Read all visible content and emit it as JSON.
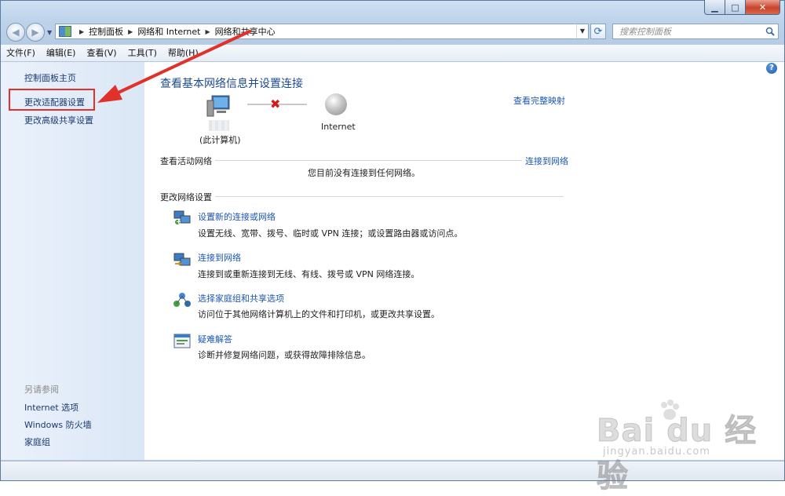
{
  "window": {
    "minimize_glyph": "▁",
    "maximize_glyph": "□",
    "close_glyph": "✕"
  },
  "address_bar": {
    "crumbs": [
      "控制面板",
      "网络和 Internet",
      "网络和共享中心"
    ]
  },
  "search": {
    "placeholder": "搜索控制面板"
  },
  "menu": [
    "文件(F)",
    "编辑(E)",
    "查看(V)",
    "工具(T)",
    "帮助(H)"
  ],
  "sidebar": {
    "home": "控制面板主页",
    "change_adapter": "更改适配器设置",
    "change_sharing": "更改高级共享设置",
    "see_also_caption": "另请参阅",
    "see_also": [
      "Internet 选项",
      "Windows 防火墙",
      "家庭组"
    ]
  },
  "main": {
    "title": "查看基本网络信息并设置连接",
    "view_full_map": "查看完整映射",
    "this_computer": "(此计算机)",
    "internet_label": "Internet",
    "active_networks_title": "查看活动网络",
    "connect_to_network_link": "连接到网络",
    "no_connection": "您目前没有连接到任何网络。",
    "change_settings_title": "更改网络设置",
    "tasks": [
      {
        "title": "设置新的连接或网络",
        "desc": "设置无线、宽带、拨号、临时或 VPN 连接；或设置路由器或访问点。",
        "icon": "network-setup-icon"
      },
      {
        "title": "连接到网络",
        "desc": "连接到或重新连接到无线、有线、拨号或 VPN 网络连接。",
        "icon": "network-connect-icon"
      },
      {
        "title": "选择家庭组和共享选项",
        "desc": "访问位于其他网络计算机上的文件和打印机，或更改共享设置。",
        "icon": "homegroup-icon"
      },
      {
        "title": "疑难解答",
        "desc": "诊断并修复网络问题，或获得故障排除信息。",
        "icon": "troubleshoot-icon"
      }
    ]
  },
  "help_glyph": "?",
  "watermark": {
    "logo": "Bai du 经验",
    "url": "jingyan.baidu.com"
  },
  "colors": {
    "link": "#1c56b3",
    "annotation": "#e0322b",
    "title": "#1c4a8c"
  }
}
